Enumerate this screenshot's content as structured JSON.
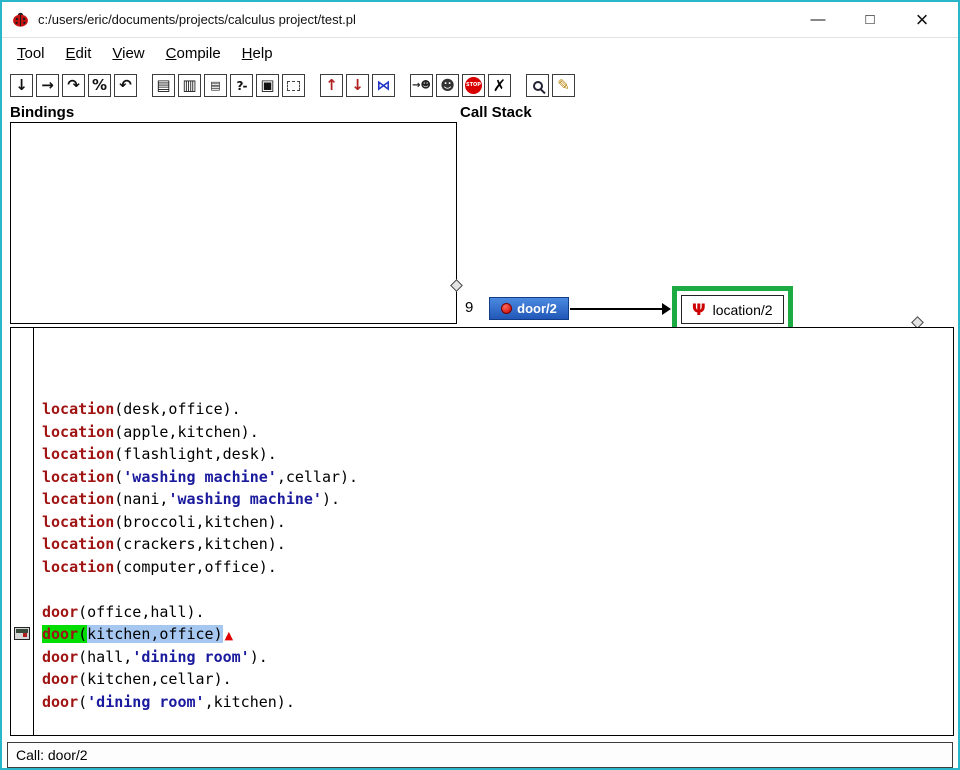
{
  "window": {
    "title": "c:/users/eric/documents/projects/calculus project/test.pl",
    "minimize_glyph": "—",
    "maximize_glyph": "□",
    "close_glyph": "×"
  },
  "menu": [
    "Tool",
    "Edit",
    "View",
    "Compile",
    "Help"
  ],
  "toolbar": [
    {
      "name": "step-into-button",
      "icon": "down-arrow-icon",
      "glyph": "↓"
    },
    {
      "name": "step-over-button",
      "icon": "right-arrow-icon",
      "glyph": "→"
    },
    {
      "name": "step-out-button",
      "icon": "curved-right-arrow-icon",
      "glyph": "↷"
    },
    {
      "name": "retry-button",
      "icon": "percent-skip-icon",
      "glyph": "%"
    },
    {
      "name": "undo-step-button",
      "icon": "curved-left-arrow-icon",
      "glyph": "↶"
    },
    {
      "sep": true
    },
    {
      "name": "listing-button",
      "icon": "listing-doc-icon",
      "glyph": "▤"
    },
    {
      "name": "listing-down-button",
      "icon": "listing-down-doc-icon",
      "glyph": "▥"
    },
    {
      "name": "clause-button",
      "icon": "small-doc-icon",
      "glyph": "▤",
      "cls": "small"
    },
    {
      "name": "query-button",
      "icon": "query-prompt-icon",
      "glyph": "?-",
      "cls": "text"
    },
    {
      "name": "details-button",
      "icon": "filled-box-icon",
      "glyph": "▣"
    },
    {
      "name": "region-button",
      "icon": "dashed-box-icon",
      "glyph": "",
      "cls": "dashed"
    },
    {
      "sep": true
    },
    {
      "name": "up-stack-button",
      "icon": "person-up-icon",
      "glyph": "↑",
      "cls": "figure"
    },
    {
      "name": "down-stack-button",
      "icon": "person-down-icon",
      "glyph": "↓",
      "cls": "figure"
    },
    {
      "name": "nodebug-button",
      "icon": "butterfly-icon",
      "glyph": "⋈",
      "cls": "butterfly"
    },
    {
      "sep": true
    },
    {
      "name": "goto-frame-button",
      "icon": "arrow-person-icon",
      "glyph": "→☻",
      "cls": "duo"
    },
    {
      "name": "interrupt-button",
      "icon": "person-icon",
      "glyph": "☻",
      "cls": "person"
    },
    {
      "name": "stop-button",
      "icon": "stop-sign-icon",
      "glyph": "STOP",
      "cls": "stop"
    },
    {
      "name": "abort-button",
      "icon": "cross-icon",
      "glyph": "✗",
      "cls": "cross"
    },
    {
      "sep": true
    },
    {
      "name": "zoom-button",
      "icon": "magnifier-icon",
      "glyph": "",
      "cls": "magnifier"
    },
    {
      "name": "edit-source-button",
      "icon": "pencil-icon",
      "glyph": "✎",
      "cls": "pencil"
    }
  ],
  "panel_labels": {
    "bindings": "Bindings",
    "call_stack": "Call Stack"
  },
  "call_stack": {
    "depth": "9",
    "frame": "door/2",
    "called": "location/2",
    "called_icon_glyph": "Ψ"
  },
  "source": {
    "current_line": 10,
    "lines": [
      {
        "segs": [
          {
            "t": "location",
            "s": "pred"
          },
          {
            "t": "(desk,office).",
            "s": "plain"
          }
        ]
      },
      {
        "segs": [
          {
            "t": "location",
            "s": "pred"
          },
          {
            "t": "(apple,kitchen).",
            "s": "plain"
          }
        ]
      },
      {
        "segs": [
          {
            "t": "location",
            "s": "pred"
          },
          {
            "t": "(flashlight,desk).",
            "s": "plain"
          }
        ]
      },
      {
        "segs": [
          {
            "t": "location",
            "s": "pred"
          },
          {
            "t": "(",
            "s": "plain"
          },
          {
            "t": "'washing machine'",
            "s": "atom"
          },
          {
            "t": ",cellar).",
            "s": "plain"
          }
        ]
      },
      {
        "segs": [
          {
            "t": "location",
            "s": "pred"
          },
          {
            "t": "(nani,",
            "s": "plain"
          },
          {
            "t": "'washing machine'",
            "s": "atom"
          },
          {
            "t": ").",
            "s": "plain"
          }
        ]
      },
      {
        "segs": [
          {
            "t": "location",
            "s": "pred"
          },
          {
            "t": "(broccoli,kitchen).",
            "s": "plain"
          }
        ]
      },
      {
        "segs": [
          {
            "t": "location",
            "s": "pred"
          },
          {
            "t": "(crackers,kitchen).",
            "s": "plain"
          }
        ]
      },
      {
        "segs": [
          {
            "t": "location",
            "s": "pred"
          },
          {
            "t": "(computer,office).",
            "s": "plain"
          }
        ]
      },
      {
        "segs": []
      },
      {
        "segs": [
          {
            "t": "door",
            "s": "pred"
          },
          {
            "t": "(office,hall).",
            "s": "plain"
          }
        ]
      },
      {
        "segs": [
          {
            "t": "door",
            "s": "pred hl"
          },
          {
            "t": "(",
            "s": "plain hl"
          },
          {
            "t": "kitchen,office)",
            "s": "plain sel"
          },
          {
            "t": ".",
            "s": "plain"
          },
          {
            "t": "▲",
            "s": "marker"
          }
        ]
      },
      {
        "segs": [
          {
            "t": "door",
            "s": "pred"
          },
          {
            "t": "(hall,",
            "s": "plain"
          },
          {
            "t": "'dining room'",
            "s": "atom"
          },
          {
            "t": ").",
            "s": "plain"
          }
        ]
      },
      {
        "segs": [
          {
            "t": "door",
            "s": "pred"
          },
          {
            "t": "(kitchen,cellar).",
            "s": "plain"
          }
        ]
      },
      {
        "segs": [
          {
            "t": "door",
            "s": "pred"
          },
          {
            "t": "(",
            "s": "plain"
          },
          {
            "t": "'dining room'",
            "s": "atom"
          },
          {
            "t": ",kitchen).",
            "s": "plain"
          }
        ]
      }
    ]
  },
  "status": {
    "text": "Call: door/2"
  },
  "colors": {
    "window_border": "#2ab6c9",
    "highlight_green": "#00dd00",
    "selection_blue": "#a6c8f0",
    "frame_button_blue": "#2a6fd6",
    "focus_ring_green": "#1bab42",
    "predicate_red": "#a01313",
    "atom_blue": "#1a1a9e"
  }
}
